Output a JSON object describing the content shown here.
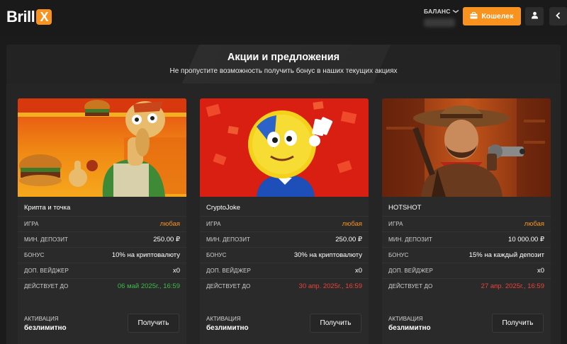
{
  "brand": {
    "logo_text": "Brill",
    "logo_badge": "X",
    "accent_color": "#f7931e"
  },
  "header": {
    "balance_label": "БАЛАНС",
    "wallet_label": "Кошелек",
    "icons": [
      "briefcase-icon",
      "user-icon",
      "chevron-left-icon",
      "chevron-down-icon"
    ]
  },
  "promo": {
    "title": "Акции и предложения",
    "subtitle": "Не пропустите возможность получить бонус в наших текущих акциях"
  },
  "labels": {
    "game": "ИГРА",
    "min_deposit": "МИН. ДЕПОЗИТ",
    "bonus": "БОНУС",
    "wager": "ДОП. ВЕЙДЖЕР",
    "valid_until": "ДЕЙСТВУЕТ ДО",
    "activation": "АКТИВАЦИЯ",
    "get_button": "Получить"
  },
  "cards": [
    {
      "name": "Крипта и точка",
      "game": "любая",
      "min_deposit": "250.00 ₽",
      "bonus": "10% на криптовалюту",
      "wager": "x0",
      "valid_until": "06 май 2025г., 16:59",
      "valid_color": "#3fb94a",
      "activation": "безлимитно"
    },
    {
      "name": "CryptoJoke",
      "game": "любая",
      "min_deposit": "250.00 ₽",
      "bonus": "30% на криптовалюту",
      "wager": "x0",
      "valid_until": "30 апр. 2025г., 16:59",
      "valid_color": "#e8443a",
      "activation": "безлимитно"
    },
    {
      "name": "HOTSHOT",
      "game": "любая",
      "min_deposit": "10 000.00 ₽",
      "bonus": "15% на каждый депозит",
      "wager": "x0",
      "valid_until": "27 апр. 2025г., 16:59",
      "valid_color": "#e8443a",
      "activation": "безлимитно"
    }
  ]
}
